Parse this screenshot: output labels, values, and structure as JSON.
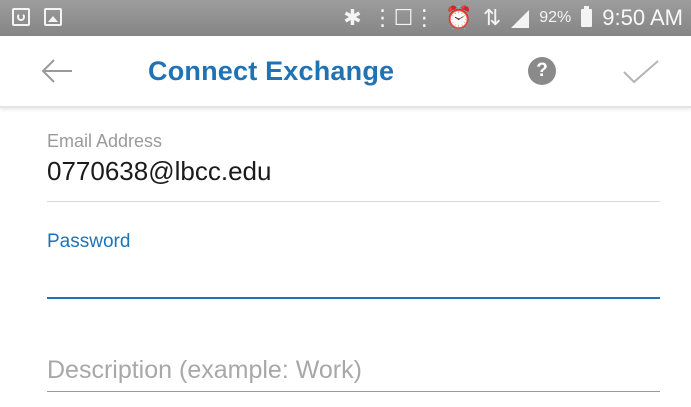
{
  "status_bar": {
    "battery_percent": "92%",
    "time": "9:50 AM",
    "left_icons": [
      "recycle-icon",
      "image-icon"
    ],
    "right_icons": [
      "bluetooth-icon",
      "vibrate-icon",
      "alarm-icon",
      "network-icon",
      "signal-icon",
      "battery-icon"
    ]
  },
  "app_bar": {
    "title": "Connect Exchange",
    "help_label": "?",
    "back_icon": "arrow-left-icon",
    "confirm_icon": "check-icon"
  },
  "form": {
    "email": {
      "label": "Email Address",
      "value": "0770638@lbcc.edu"
    },
    "password": {
      "label": "Password",
      "value": ""
    },
    "description": {
      "placeholder": "Description (example: Work)",
      "value": ""
    }
  },
  "colors": {
    "accent": "#1f73b5",
    "status_bar": "#8e8e8e",
    "label_gray": "#9a9a9a"
  }
}
